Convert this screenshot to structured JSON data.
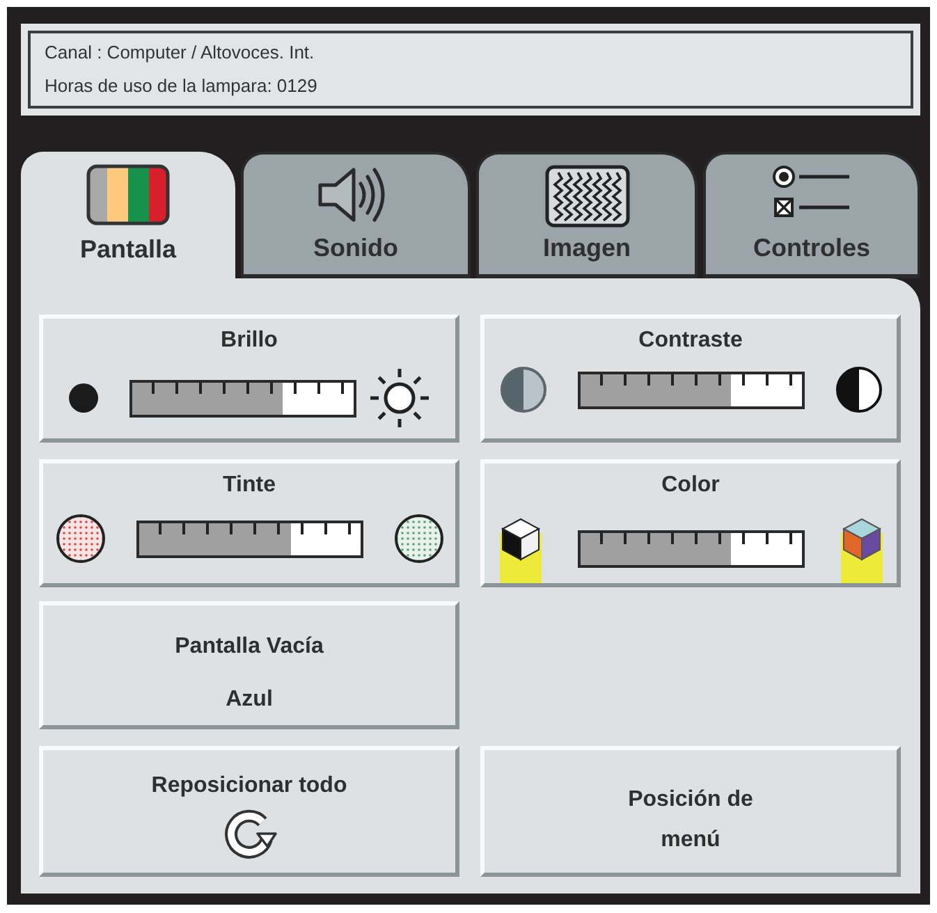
{
  "status": {
    "lines": [
      "Canal : Computer / Altovoces. Int.",
      "Horas de uso de la lampara: 0129"
    ]
  },
  "tabs": [
    {
      "label": "Pantalla",
      "selected": true
    },
    {
      "label": "Sonido",
      "selected": false
    },
    {
      "label": "Imagen",
      "selected": false
    },
    {
      "label": "Controles",
      "selected": false
    }
  ],
  "panel": {
    "rows": [
      [
        {
          "kind": "slider",
          "label": "Brillo",
          "level": 0.68
        },
        {
          "kind": "slider",
          "label": "Contraste",
          "level": 0.68
        }
      ],
      [
        {
          "kind": "slider",
          "label": "Tinte",
          "level": 0.69
        },
        {
          "kind": "slider",
          "label": "Color",
          "level": 0.68
        }
      ],
      [
        {
          "kind": "option",
          "label": "Pantalla Vacía",
          "value": "Azul"
        }
      ],
      [
        {
          "kind": "action",
          "label": "Reposicionar todo"
        },
        {
          "kind": "button",
          "label": "Posición de menú"
        }
      ]
    ]
  }
}
